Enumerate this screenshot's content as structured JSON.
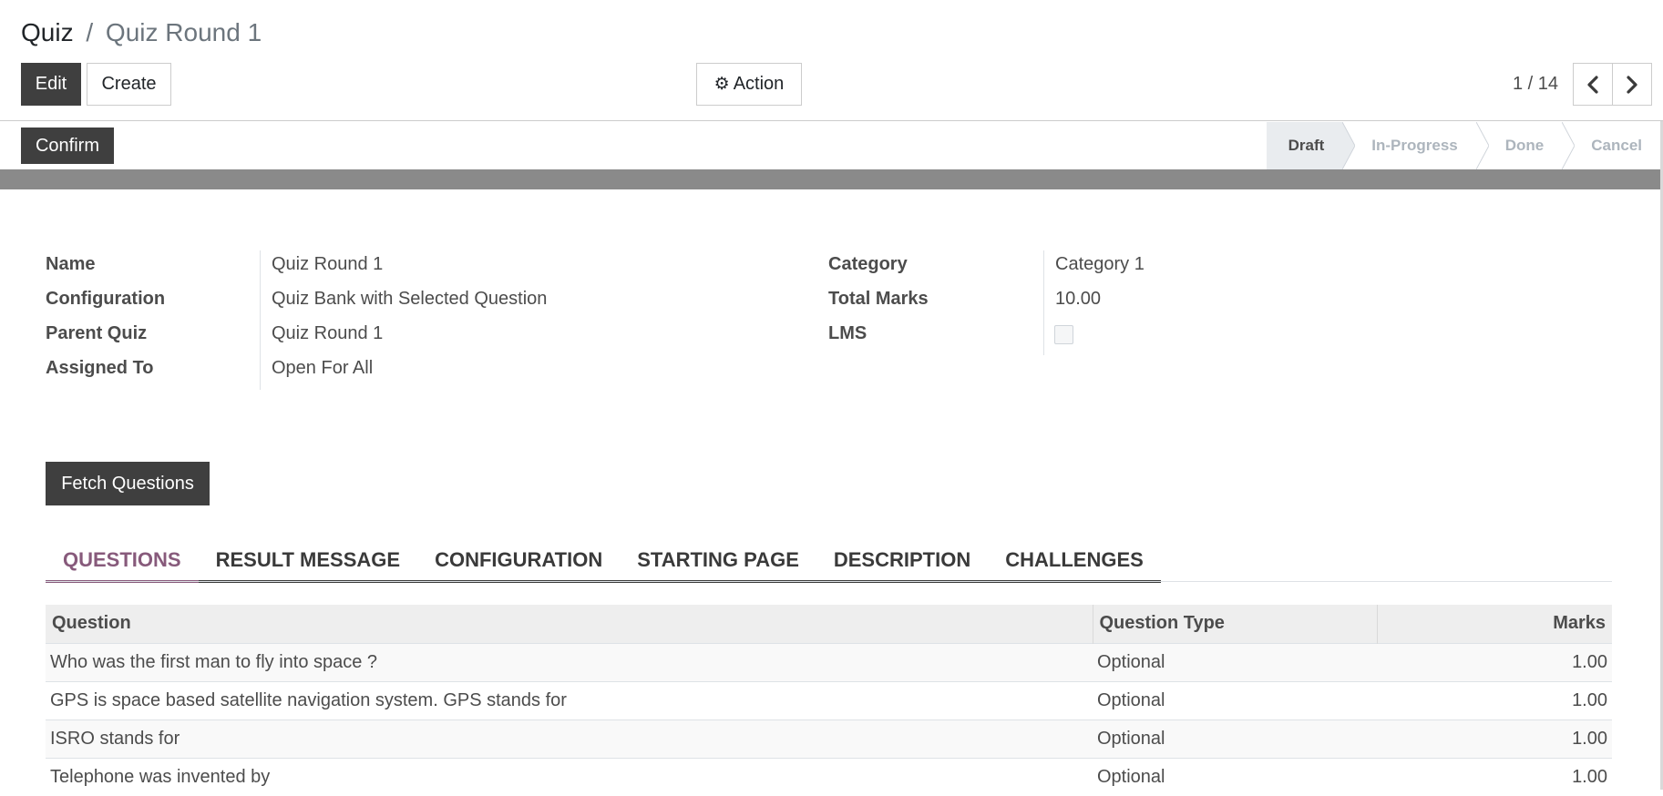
{
  "breadcrumb": {
    "root": "Quiz",
    "separator": "/",
    "current": "Quiz Round 1"
  },
  "toolbar": {
    "edit_label": "Edit",
    "create_label": "Create",
    "action_label": "Action"
  },
  "pager": {
    "value": "1 / 14"
  },
  "header": {
    "confirm_label": "Confirm",
    "stages": [
      "Draft",
      "In-Progress",
      "Done",
      "Cancel"
    ],
    "active_stage": "Draft"
  },
  "form": {
    "name_label": "Name",
    "name_value": "Quiz Round 1",
    "configuration_label": "Configuration",
    "configuration_value": "Quiz Bank with Selected Question",
    "parent_quiz_label": "Parent Quiz",
    "parent_quiz_value": "Quiz Round 1",
    "assigned_to_label": "Assigned To",
    "assigned_to_value": "Open For All",
    "category_label": "Category",
    "category_value": "Category 1",
    "total_marks_label": "Total Marks",
    "total_marks_value": "10.00",
    "lms_label": "LMS",
    "lms_checked": false
  },
  "fetch_label": "Fetch Questions",
  "tabs": [
    {
      "label": "QUESTIONS",
      "active": true
    },
    {
      "label": "RESULT MESSAGE"
    },
    {
      "label": "CONFIGURATION"
    },
    {
      "label": "STARTING PAGE"
    },
    {
      "label": "DESCRIPTION"
    },
    {
      "label": "CHALLENGES"
    }
  ],
  "table": {
    "columns": [
      "Question",
      "Question Type",
      "Marks"
    ],
    "rows": [
      {
        "question": "Who was the first man to fly into space ?",
        "type": "Optional",
        "marks": "1.00"
      },
      {
        "question": "GPS is space based satellite navigation system. GPS stands for",
        "type": "Optional",
        "marks": "1.00"
      },
      {
        "question": "ISRO stands for",
        "type": "Optional",
        "marks": "1.00"
      },
      {
        "question": "Telephone was invented by",
        "type": "Optional",
        "marks": "1.00"
      }
    ]
  },
  "colors": {
    "primary_dark": "#3f3f3f",
    "accent": "#875a7b",
    "header_band": "#8a8a8a"
  }
}
